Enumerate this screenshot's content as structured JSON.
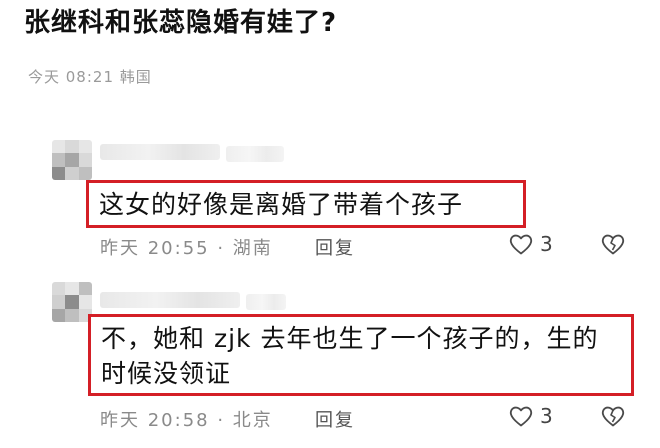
{
  "post": {
    "title": "张继科和张蕊隐婚有娃了?",
    "meta": "今天 08:21 韩国"
  },
  "comments": [
    {
      "text": "这女的好像是离婚了带着个孩子",
      "meta": "昨天 20:55 · 湖南",
      "reply_label": "回复",
      "likes": "3",
      "like_icon": "heart-icon",
      "dislike_icon": "broken-heart-icon"
    },
    {
      "text": "不，她和 zjk 去年也生了一个孩子的，生的时候没领证",
      "meta": "昨天 20:58 · 北京",
      "reply_label": "回复",
      "likes": "3",
      "like_icon": "heart-icon",
      "dislike_icon": "broken-heart-icon"
    }
  ],
  "colors": {
    "highlight_border": "#d41f26",
    "meta_text": "#9a9a9a"
  }
}
